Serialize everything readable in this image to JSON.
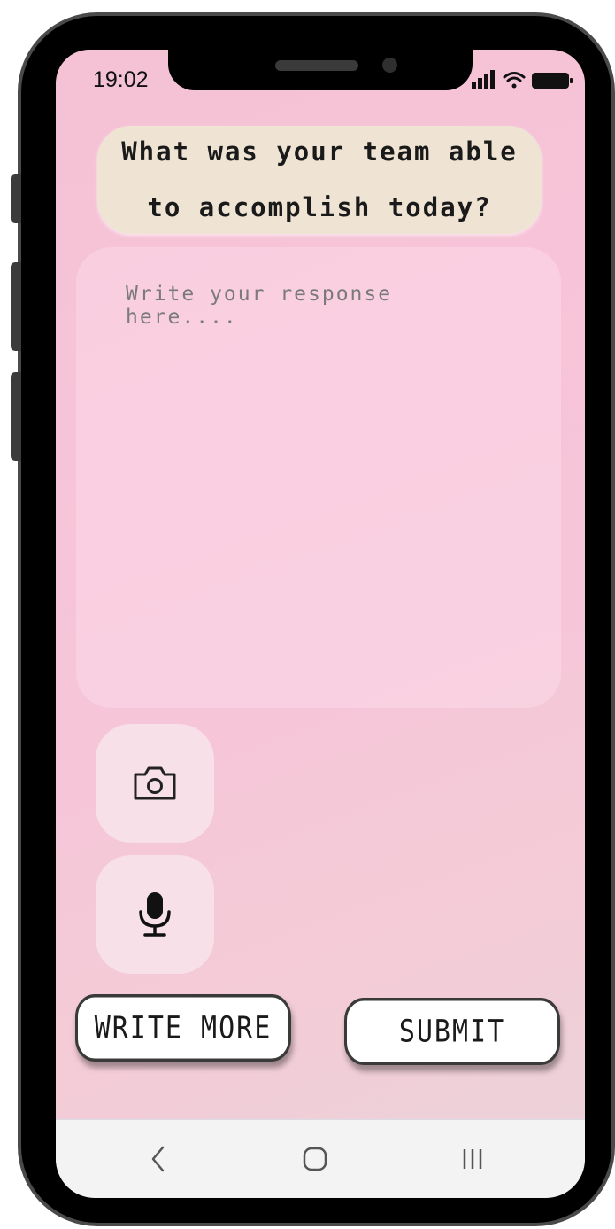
{
  "status_bar": {
    "time": "19:02",
    "icons": [
      "signal-icon",
      "wifi-icon",
      "battery-icon"
    ]
  },
  "prompt": {
    "question": "What was your team able to accomplish today?"
  },
  "response": {
    "placeholder": "Write your response here....",
    "value": ""
  },
  "tools": [
    {
      "icon": "camera-icon"
    },
    {
      "icon": "microphone-icon"
    }
  ],
  "actions": {
    "write_more_label": "WRITE MORE",
    "submit_label": "SUBMIT"
  },
  "navigation": {
    "icons": [
      "back-icon",
      "home-icon",
      "recent-apps-icon"
    ]
  },
  "colors": {
    "background": "#f7c3d8",
    "question_card": "#efe4d4",
    "button_border": "#3a3a3a"
  }
}
